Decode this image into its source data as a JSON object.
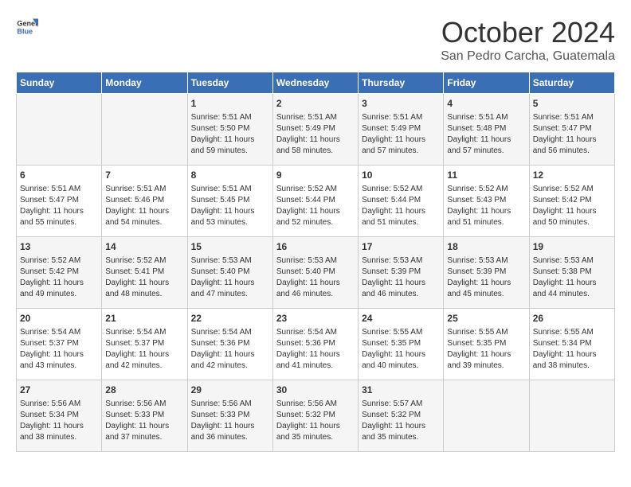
{
  "header": {
    "logo_line1": "General",
    "logo_line2": "Blue",
    "month_title": "October 2024",
    "subtitle": "San Pedro Carcha, Guatemala"
  },
  "weekdays": [
    "Sunday",
    "Monday",
    "Tuesday",
    "Wednesday",
    "Thursday",
    "Friday",
    "Saturday"
  ],
  "weeks": [
    [
      {
        "day": "",
        "sunrise": "",
        "sunset": "",
        "daylight": ""
      },
      {
        "day": "",
        "sunrise": "",
        "sunset": "",
        "daylight": ""
      },
      {
        "day": "1",
        "sunrise": "Sunrise: 5:51 AM",
        "sunset": "Sunset: 5:50 PM",
        "daylight": "Daylight: 11 hours and 59 minutes."
      },
      {
        "day": "2",
        "sunrise": "Sunrise: 5:51 AM",
        "sunset": "Sunset: 5:49 PM",
        "daylight": "Daylight: 11 hours and 58 minutes."
      },
      {
        "day": "3",
        "sunrise": "Sunrise: 5:51 AM",
        "sunset": "Sunset: 5:49 PM",
        "daylight": "Daylight: 11 hours and 57 minutes."
      },
      {
        "day": "4",
        "sunrise": "Sunrise: 5:51 AM",
        "sunset": "Sunset: 5:48 PM",
        "daylight": "Daylight: 11 hours and 57 minutes."
      },
      {
        "day": "5",
        "sunrise": "Sunrise: 5:51 AM",
        "sunset": "Sunset: 5:47 PM",
        "daylight": "Daylight: 11 hours and 56 minutes."
      }
    ],
    [
      {
        "day": "6",
        "sunrise": "Sunrise: 5:51 AM",
        "sunset": "Sunset: 5:47 PM",
        "daylight": "Daylight: 11 hours and 55 minutes."
      },
      {
        "day": "7",
        "sunrise": "Sunrise: 5:51 AM",
        "sunset": "Sunset: 5:46 PM",
        "daylight": "Daylight: 11 hours and 54 minutes."
      },
      {
        "day": "8",
        "sunrise": "Sunrise: 5:51 AM",
        "sunset": "Sunset: 5:45 PM",
        "daylight": "Daylight: 11 hours and 53 minutes."
      },
      {
        "day": "9",
        "sunrise": "Sunrise: 5:52 AM",
        "sunset": "Sunset: 5:44 PM",
        "daylight": "Daylight: 11 hours and 52 minutes."
      },
      {
        "day": "10",
        "sunrise": "Sunrise: 5:52 AM",
        "sunset": "Sunset: 5:44 PM",
        "daylight": "Daylight: 11 hours and 51 minutes."
      },
      {
        "day": "11",
        "sunrise": "Sunrise: 5:52 AM",
        "sunset": "Sunset: 5:43 PM",
        "daylight": "Daylight: 11 hours and 51 minutes."
      },
      {
        "day": "12",
        "sunrise": "Sunrise: 5:52 AM",
        "sunset": "Sunset: 5:42 PM",
        "daylight": "Daylight: 11 hours and 50 minutes."
      }
    ],
    [
      {
        "day": "13",
        "sunrise": "Sunrise: 5:52 AM",
        "sunset": "Sunset: 5:42 PM",
        "daylight": "Daylight: 11 hours and 49 minutes."
      },
      {
        "day": "14",
        "sunrise": "Sunrise: 5:52 AM",
        "sunset": "Sunset: 5:41 PM",
        "daylight": "Daylight: 11 hours and 48 minutes."
      },
      {
        "day": "15",
        "sunrise": "Sunrise: 5:53 AM",
        "sunset": "Sunset: 5:40 PM",
        "daylight": "Daylight: 11 hours and 47 minutes."
      },
      {
        "day": "16",
        "sunrise": "Sunrise: 5:53 AM",
        "sunset": "Sunset: 5:40 PM",
        "daylight": "Daylight: 11 hours and 46 minutes."
      },
      {
        "day": "17",
        "sunrise": "Sunrise: 5:53 AM",
        "sunset": "Sunset: 5:39 PM",
        "daylight": "Daylight: 11 hours and 46 minutes."
      },
      {
        "day": "18",
        "sunrise": "Sunrise: 5:53 AM",
        "sunset": "Sunset: 5:39 PM",
        "daylight": "Daylight: 11 hours and 45 minutes."
      },
      {
        "day": "19",
        "sunrise": "Sunrise: 5:53 AM",
        "sunset": "Sunset: 5:38 PM",
        "daylight": "Daylight: 11 hours and 44 minutes."
      }
    ],
    [
      {
        "day": "20",
        "sunrise": "Sunrise: 5:54 AM",
        "sunset": "Sunset: 5:37 PM",
        "daylight": "Daylight: 11 hours and 43 minutes."
      },
      {
        "day": "21",
        "sunrise": "Sunrise: 5:54 AM",
        "sunset": "Sunset: 5:37 PM",
        "daylight": "Daylight: 11 hours and 42 minutes."
      },
      {
        "day": "22",
        "sunrise": "Sunrise: 5:54 AM",
        "sunset": "Sunset: 5:36 PM",
        "daylight": "Daylight: 11 hours and 42 minutes."
      },
      {
        "day": "23",
        "sunrise": "Sunrise: 5:54 AM",
        "sunset": "Sunset: 5:36 PM",
        "daylight": "Daylight: 11 hours and 41 minutes."
      },
      {
        "day": "24",
        "sunrise": "Sunrise: 5:55 AM",
        "sunset": "Sunset: 5:35 PM",
        "daylight": "Daylight: 11 hours and 40 minutes."
      },
      {
        "day": "25",
        "sunrise": "Sunrise: 5:55 AM",
        "sunset": "Sunset: 5:35 PM",
        "daylight": "Daylight: 11 hours and 39 minutes."
      },
      {
        "day": "26",
        "sunrise": "Sunrise: 5:55 AM",
        "sunset": "Sunset: 5:34 PM",
        "daylight": "Daylight: 11 hours and 38 minutes."
      }
    ],
    [
      {
        "day": "27",
        "sunrise": "Sunrise: 5:56 AM",
        "sunset": "Sunset: 5:34 PM",
        "daylight": "Daylight: 11 hours and 38 minutes."
      },
      {
        "day": "28",
        "sunrise": "Sunrise: 5:56 AM",
        "sunset": "Sunset: 5:33 PM",
        "daylight": "Daylight: 11 hours and 37 minutes."
      },
      {
        "day": "29",
        "sunrise": "Sunrise: 5:56 AM",
        "sunset": "Sunset: 5:33 PM",
        "daylight": "Daylight: 11 hours and 36 minutes."
      },
      {
        "day": "30",
        "sunrise": "Sunrise: 5:56 AM",
        "sunset": "Sunset: 5:32 PM",
        "daylight": "Daylight: 11 hours and 35 minutes."
      },
      {
        "day": "31",
        "sunrise": "Sunrise: 5:57 AM",
        "sunset": "Sunset: 5:32 PM",
        "daylight": "Daylight: 11 hours and 35 minutes."
      },
      {
        "day": "",
        "sunrise": "",
        "sunset": "",
        "daylight": ""
      },
      {
        "day": "",
        "sunrise": "",
        "sunset": "",
        "daylight": ""
      }
    ]
  ]
}
